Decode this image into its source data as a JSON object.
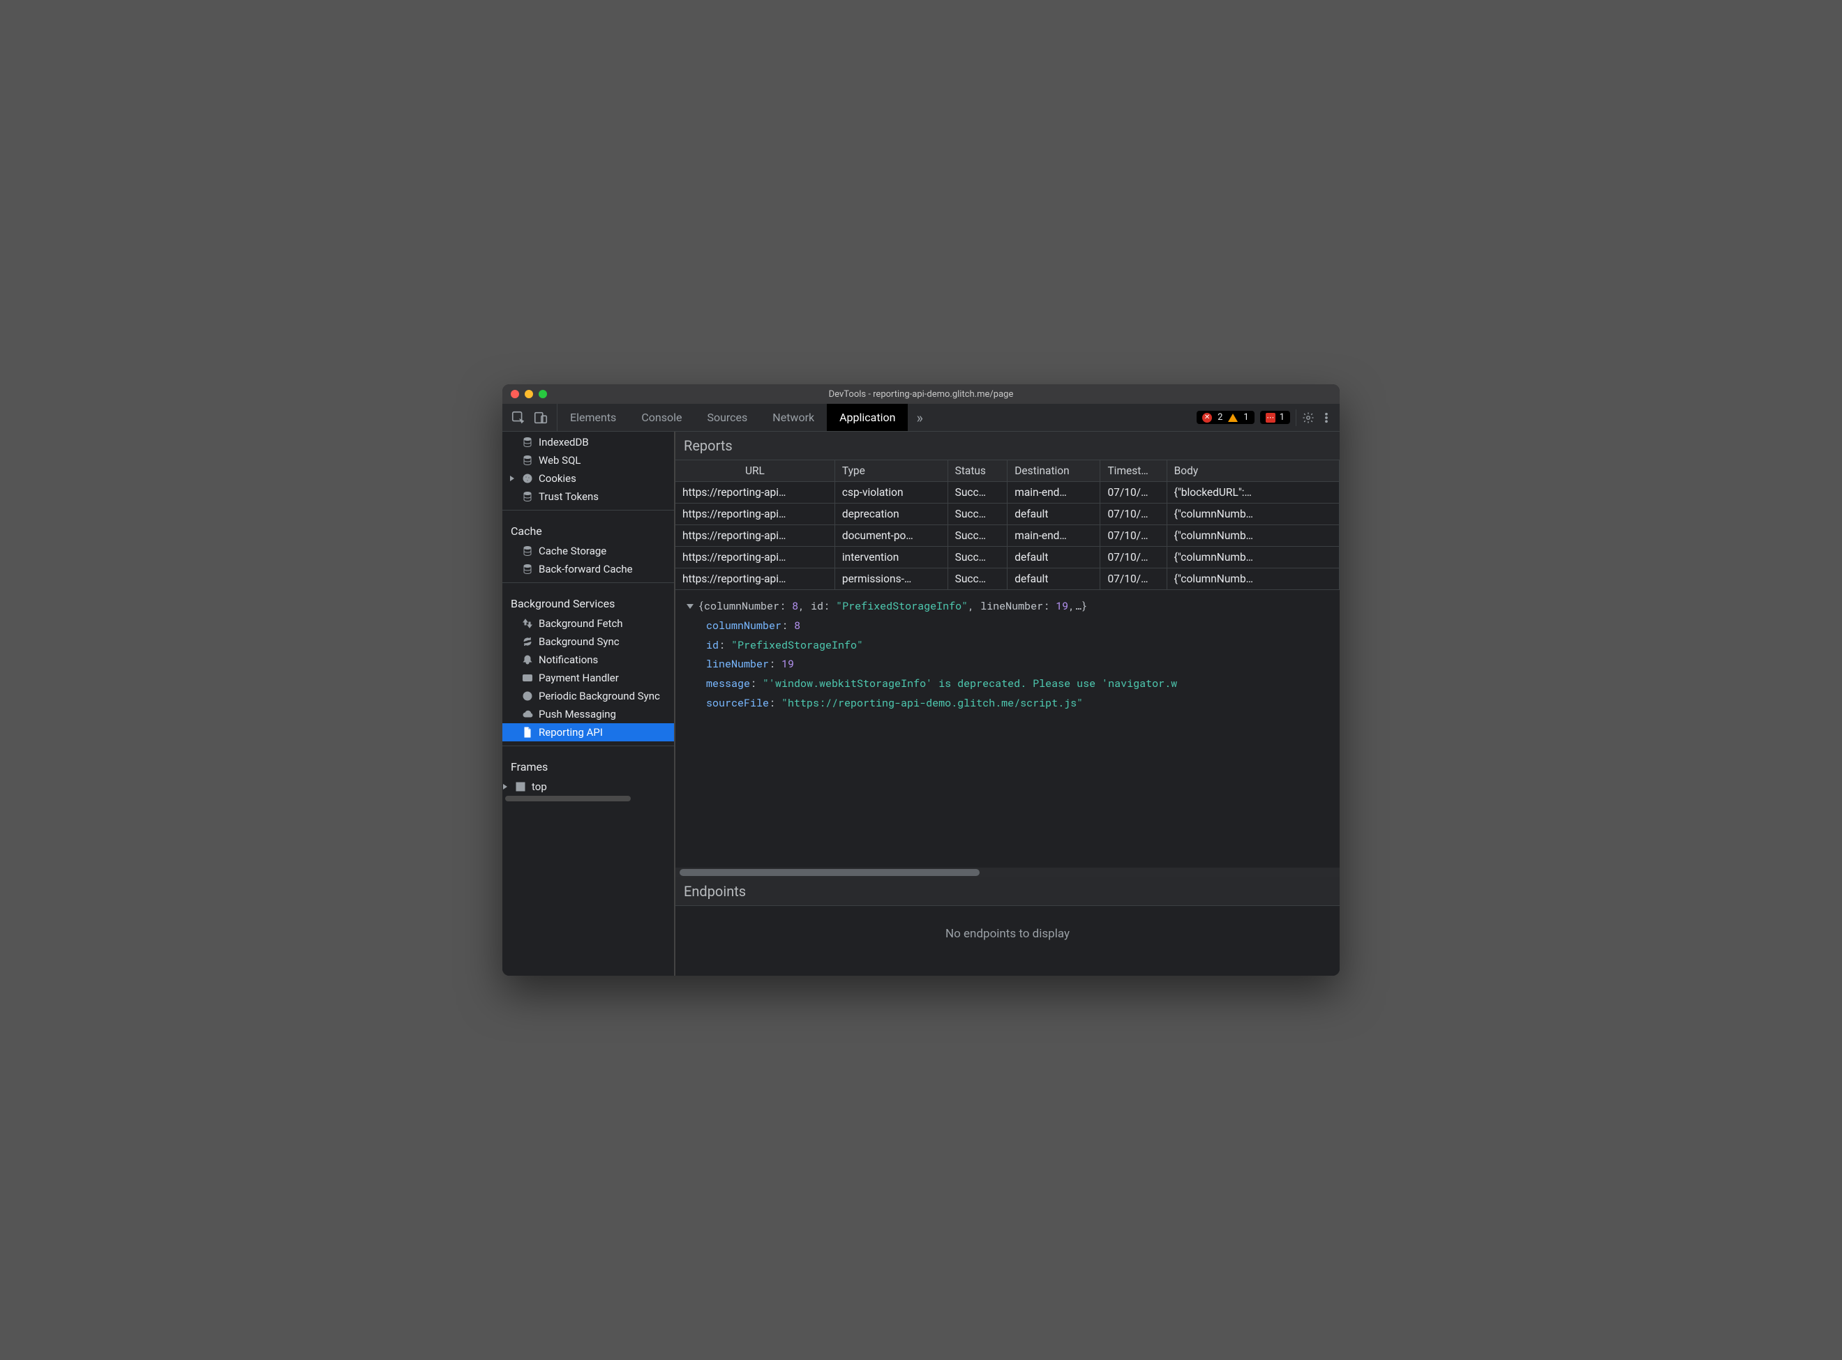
{
  "window": {
    "title": "DevTools - reporting-api-demo.glitch.me/page"
  },
  "tabs": {
    "items": [
      "Elements",
      "Console",
      "Sources",
      "Network",
      "Application"
    ],
    "active_index": 4,
    "more": "»"
  },
  "status": {
    "errors": "2",
    "warnings": "1",
    "issues": "1"
  },
  "sidebar": {
    "storage_items": [
      {
        "id": "indexeddb",
        "label": "IndexedDB",
        "icon": "db"
      },
      {
        "id": "websql",
        "label": "Web SQL",
        "icon": "db"
      },
      {
        "id": "cookies",
        "label": "Cookies",
        "icon": "cookie",
        "expandable": true
      },
      {
        "id": "trusttokens",
        "label": "Trust Tokens",
        "icon": "db"
      }
    ],
    "cache_header": "Cache",
    "cache_items": [
      {
        "id": "cachestorage",
        "label": "Cache Storage",
        "icon": "db"
      },
      {
        "id": "bfcache",
        "label": "Back-forward Cache",
        "icon": "db"
      }
    ],
    "bg_header": "Background Services",
    "bg_items": [
      {
        "id": "bgfetch",
        "label": "Background Fetch",
        "icon": "updown"
      },
      {
        "id": "bgsync",
        "label": "Background Sync",
        "icon": "sync"
      },
      {
        "id": "notif",
        "label": "Notifications",
        "icon": "bell"
      },
      {
        "id": "payment",
        "label": "Payment Handler",
        "icon": "card"
      },
      {
        "id": "periodic",
        "label": "Periodic Background Sync",
        "icon": "clock"
      },
      {
        "id": "push",
        "label": "Push Messaging",
        "icon": "cloud"
      },
      {
        "id": "reporting",
        "label": "Reporting API",
        "icon": "file",
        "selected": true
      }
    ],
    "frames_header": "Frames",
    "frames": [
      {
        "id": "top",
        "label": "top",
        "expandable": true
      }
    ]
  },
  "reports": {
    "header": "Reports",
    "columns": [
      "URL",
      "Type",
      "Status",
      "Destination",
      "Timest…",
      "Body"
    ],
    "rows": [
      {
        "url": "https://reporting-api…",
        "type": "csp-violation",
        "status": "Succ…",
        "destination": "main-end…",
        "timestamp": "07/10/…",
        "body": "{\"blockedURL\":…"
      },
      {
        "url": "https://reporting-api…",
        "type": "deprecation",
        "status": "Succ…",
        "destination": "default",
        "timestamp": "07/10/…",
        "body": "{\"columnNumb…"
      },
      {
        "url": "https://reporting-api…",
        "type": "document-po…",
        "status": "Succ…",
        "destination": "main-end…",
        "timestamp": "07/10/…",
        "body": "{\"columnNumb…"
      },
      {
        "url": "https://reporting-api…",
        "type": "intervention",
        "status": "Succ…",
        "destination": "default",
        "timestamp": "07/10/…",
        "body": "{\"columnNumb…"
      },
      {
        "url": "https://reporting-api…",
        "type": "permissions-…",
        "status": "Succ…",
        "destination": "default",
        "timestamp": "07/10/…",
        "body": "{\"columnNumb…"
      }
    ]
  },
  "detail": {
    "summary_prefix": "{columnNumber: ",
    "summary_col": "8",
    "summary_mid": ", id: ",
    "summary_id": "\"PrefixedStorageInfo\"",
    "summary_mid2": ", lineNumber: ",
    "summary_line": "19",
    "summary_suffix": ",…}",
    "k_columnNumber": "columnNumber",
    "v_columnNumber": "8",
    "k_id": "id",
    "v_id": "\"PrefixedStorageInfo\"",
    "k_lineNumber": "lineNumber",
    "v_lineNumber": "19",
    "k_message": "message",
    "v_message": "\"'window.webkitStorageInfo' is deprecated. Please use 'navigator.w",
    "k_sourceFile": "sourceFile",
    "v_sourceFile": "\"https://reporting-api-demo.glitch.me/script.js\""
  },
  "endpoints": {
    "header": "Endpoints",
    "empty": "No endpoints to display"
  }
}
